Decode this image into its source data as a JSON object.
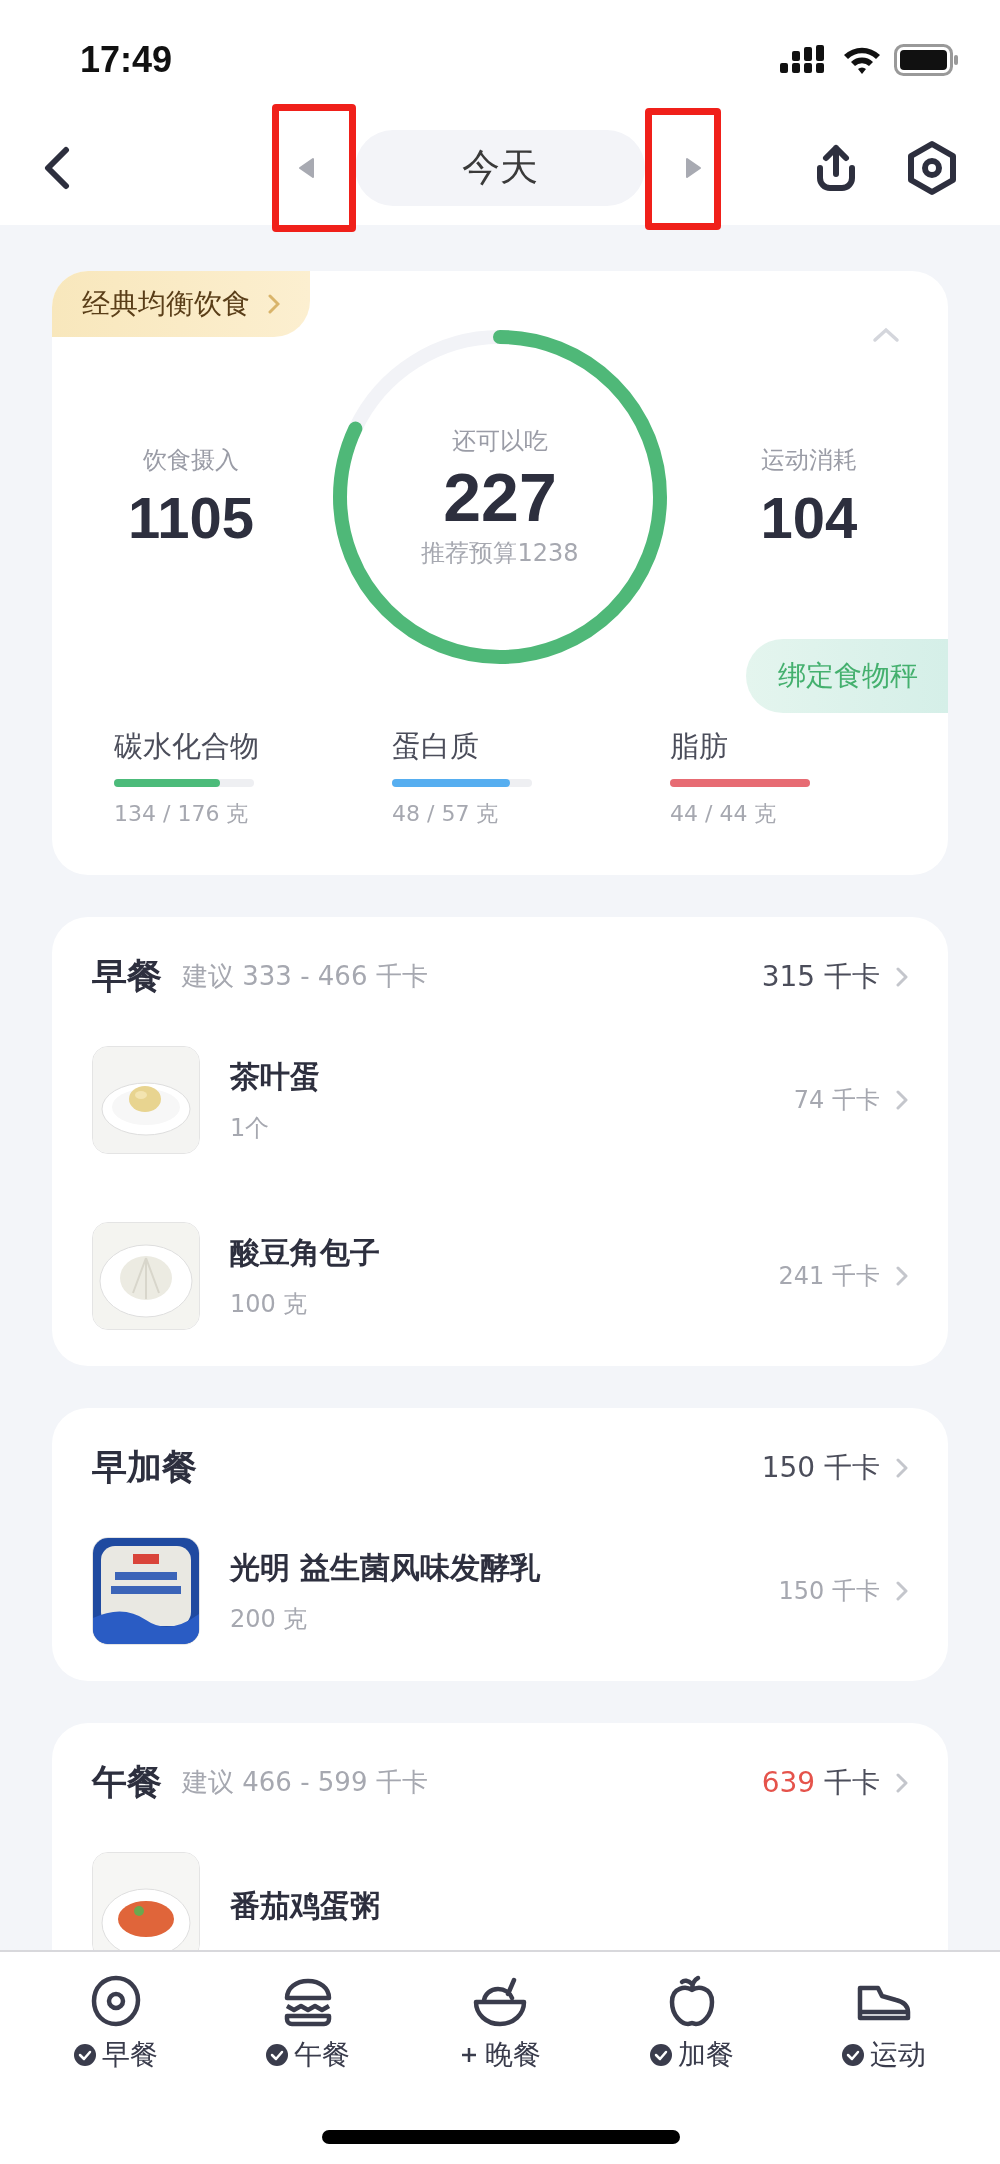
{
  "status_bar": {
    "time": "17:49"
  },
  "header": {
    "title": "今天"
  },
  "summary": {
    "plan": "经典均衡饮食",
    "intake": {
      "label": "饮食摄入",
      "value": "1105"
    },
    "remaining": {
      "label": "还可以吃",
      "value": "227",
      "budget": "推荐预算1238"
    },
    "exercise": {
      "label": "运动消耗",
      "value": "104"
    },
    "scale_button": "绑定食物秤",
    "macros": [
      {
        "name": "碳水化合物",
        "level": 0.76,
        "reading": "134 / 176 克",
        "color": "#4cbb7a"
      },
      {
        "name": "蛋白质",
        "level": 0.84,
        "reading": "48 / 57 克",
        "color": "#56aef0"
      },
      {
        "name": "脂肪",
        "level": 1,
        "reading": "44 / 44 克",
        "color": "#e76b73"
      }
    ]
  },
  "meals": [
    {
      "title": "早餐",
      "suggestion": "建议 333 - 466 千卡",
      "total": "315",
      "unit": "千卡",
      "over": false,
      "items": [
        {
          "name": "茶叶蛋",
          "amount": "1个",
          "calories": "74 千卡",
          "kind": "picture"
        },
        {
          "name": "酸豆角包子",
          "amount": "100 克",
          "calories": "241 千卡",
          "kind": "picture"
        }
      ]
    },
    {
      "title": "早加餐",
      "total": "150",
      "unit": "千卡",
      "over": false,
      "items": [
        {
          "name": "光明 益生菌风味发酵乳",
          "amount": "200 克",
          "calories": "150 千卡",
          "kind": "picture"
        }
      ]
    },
    {
      "title": "午餐",
      "suggestion": "建议 466 - 599 千卡",
      "total": "639",
      "unit": "千卡",
      "over": true,
      "items": [
        {
          "name": "番茄鸡蛋粥",
          "kind": "picture"
        }
      ]
    }
  ],
  "nav": [
    {
      "label": "早餐",
      "checked": true
    },
    {
      "label": "午餐",
      "checked": true
    },
    {
      "label": "晚餐",
      "checked": false
    },
    {
      "label": "加餐",
      "checked": true
    },
    {
      "label": "运动",
      "checked": true
    }
  ]
}
